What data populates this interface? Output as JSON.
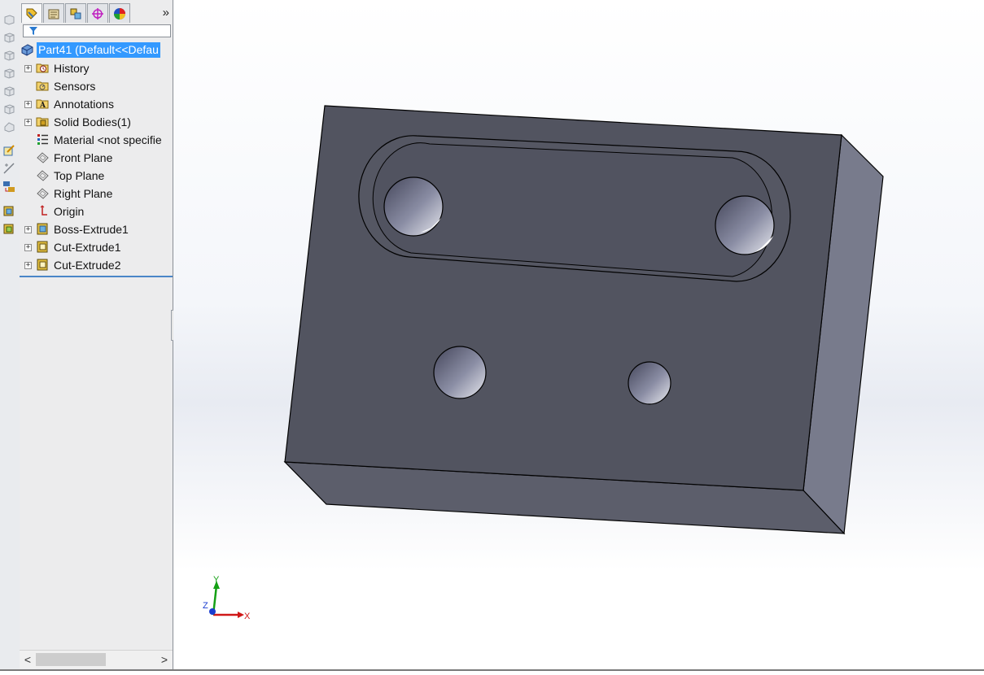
{
  "tree": {
    "root_label": "Part41  (Default<<Defau",
    "items": [
      {
        "label": "History",
        "icon": "history-folder-icon",
        "expandable": true
      },
      {
        "label": "Sensors",
        "icon": "sensors-folder-icon",
        "expandable": false
      },
      {
        "label": "Annotations",
        "icon": "annotations-icon",
        "expandable": true
      },
      {
        "label": "Solid Bodies(1)",
        "icon": "solid-bodies-folder-icon",
        "expandable": true
      },
      {
        "label": "Material <not specifie",
        "icon": "material-icon",
        "expandable": false
      },
      {
        "label": "Front Plane",
        "icon": "plane-icon",
        "expandable": false
      },
      {
        "label": "Top Plane",
        "icon": "plane-icon",
        "expandable": false
      },
      {
        "label": "Right Plane",
        "icon": "plane-icon",
        "expandable": false
      },
      {
        "label": "Origin",
        "icon": "origin-icon",
        "expandable": false
      },
      {
        "label": "Boss-Extrude1",
        "icon": "boss-extrude-icon",
        "expandable": true
      },
      {
        "label": "Cut-Extrude1",
        "icon": "cut-extrude-icon",
        "expandable": true
      },
      {
        "label": "Cut-Extrude2",
        "icon": "cut-extrude-icon",
        "expandable": true
      }
    ]
  },
  "tabs": [
    {
      "name": "feature-manager-tab",
      "icon": "feature-manager-icon"
    },
    {
      "name": "property-manager-tab",
      "icon": "property-manager-icon"
    },
    {
      "name": "configuration-manager-tab",
      "icon": "configuration-manager-icon"
    },
    {
      "name": "dimxpert-manager-tab",
      "icon": "dimxpert-icon"
    },
    {
      "name": "display-manager-tab",
      "icon": "display-manager-icon"
    }
  ],
  "tabs_more": "»",
  "scroll": {
    "left": "<",
    "right": ">"
  },
  "triad": {
    "x": "X",
    "y": "Y",
    "z": "Z"
  },
  "colors": {
    "model_front": "#525460",
    "model_side": "#7a7d8e",
    "selection": "#3399ff",
    "triad_x": "#d01818",
    "triad_y": "#14a014",
    "triad_z": "#1a3cd0"
  }
}
